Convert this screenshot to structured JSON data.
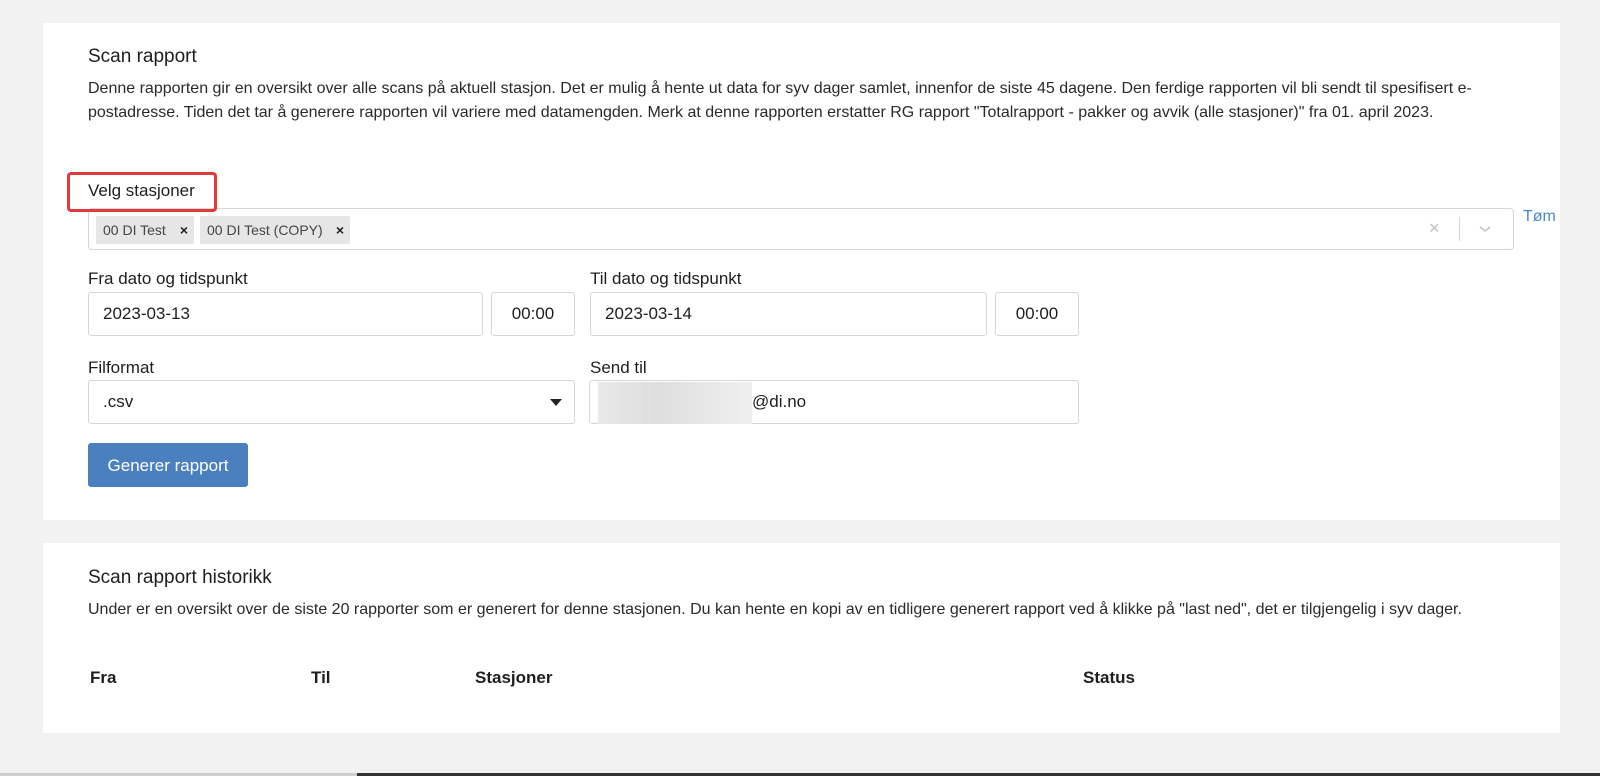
{
  "scan_report": {
    "title": "Scan rapport",
    "description": "Denne rapporten gir en oversikt over alle scans på aktuell stasjon. Det er mulig å hente ut data for syv dager samlet, innenfor de siste 45 dagene. Den ferdige rapporten vil bli sendt til spesifisert e-postadresse. Tiden det tar å generere rapporten vil variere med datamengden. Merk at denne rapporten erstatter RG rapport \"Totalrapport - pakker og avvik (alle stasjoner)\" fra 01. april 2023.",
    "stations_label": "Velg stasjoner",
    "clear_link": "Tøm",
    "selected_stations": [
      "00 DI Test",
      "00 DI Test (COPY)"
    ],
    "chip_remove": "×",
    "clear_all": "×",
    "from_label": "Fra dato og tidspunkt",
    "from_date": "2023-03-13",
    "from_time": "00:00",
    "to_label": "Til dato og tidspunkt",
    "to_date": "2023-03-14",
    "to_time": "00:00",
    "format_label": "Filformat",
    "format_value": ".csv",
    "send_to_label": "Send til",
    "email_suffix": "@di.no",
    "generate_button": "Generer rapport"
  },
  "history": {
    "title": "Scan rapport historikk",
    "description": "Under er en oversikt over de siste 20 rapporter som er generert for denne stasjonen. Du kan hente en kopi av en tidligere generert rapport ved å klikke på \"last ned\", det er tilgjengelig i syv dager.",
    "columns": [
      "Fra",
      "Til",
      "Stasjoner",
      "Status"
    ]
  },
  "colors": {
    "accent": "#4a80bd",
    "link": "#4a88c7",
    "highlight": "#e03a3a"
  }
}
